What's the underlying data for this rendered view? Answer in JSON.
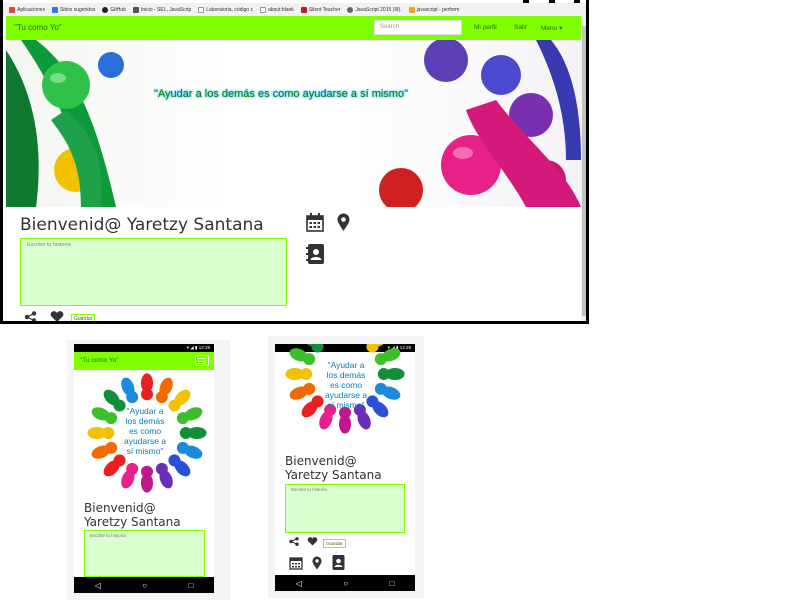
{
  "browser": {
    "bookmarks": [
      {
        "label": "Aplicaciones",
        "color": "#e04a3a"
      },
      {
        "label": "Sitios sugeridos",
        "color": "#2a7de1"
      },
      {
        "label": "GitHub",
        "color": "#222222"
      },
      {
        "label": "Inicio - SEL, JavaScrip",
        "color": "#555555"
      },
      {
        "label": "Laboratoria, código c",
        "color": "#999999"
      },
      {
        "label": "about:blank",
        "color": "#999999"
      },
      {
        "label": "Silent Teacher",
        "color": "#c02020"
      },
      {
        "label": "JavaScript 2015 (III).",
        "color": "#666666"
      },
      {
        "label": "javascript - perform",
        "color": "#f0a020"
      }
    ]
  },
  "site": {
    "brand": "\"Tu como Yo\"",
    "search_placeholder": "Search",
    "nav": {
      "profile": "Mi perfil",
      "logout": "Salir",
      "menu": "Menu ▾"
    },
    "motto": "\"Ayudar a los demás es como ayudarse a sí mismo\"",
    "welcome": "Bienvenid@ Yaretzy Santana",
    "story_placeholder": "Escribe tu historia",
    "save_label": "Guardar",
    "accent": "#7fff00"
  },
  "phone1": {
    "time": "12:29",
    "brand": "\"Tu como Yo\"",
    "motto_lines": [
      "\"Ayudar a",
      "los demás",
      "es como",
      "ayudarse a",
      "sí mismo\""
    ],
    "welcome_lines": [
      "Bienvenid@",
      "Yaretzy Santana"
    ],
    "story_placeholder": "Escribe tu historia"
  },
  "phone2": {
    "time": "12:29",
    "motto_lines": [
      "\"Ayudar a",
      "los demás",
      "es como",
      "ayudarse a",
      "sí mismo\""
    ],
    "welcome_lines": [
      "Bienvenid@",
      "Yaretzy Santana"
    ],
    "story_placeholder": "Escribe tu historia",
    "save_label": "Guardar"
  }
}
